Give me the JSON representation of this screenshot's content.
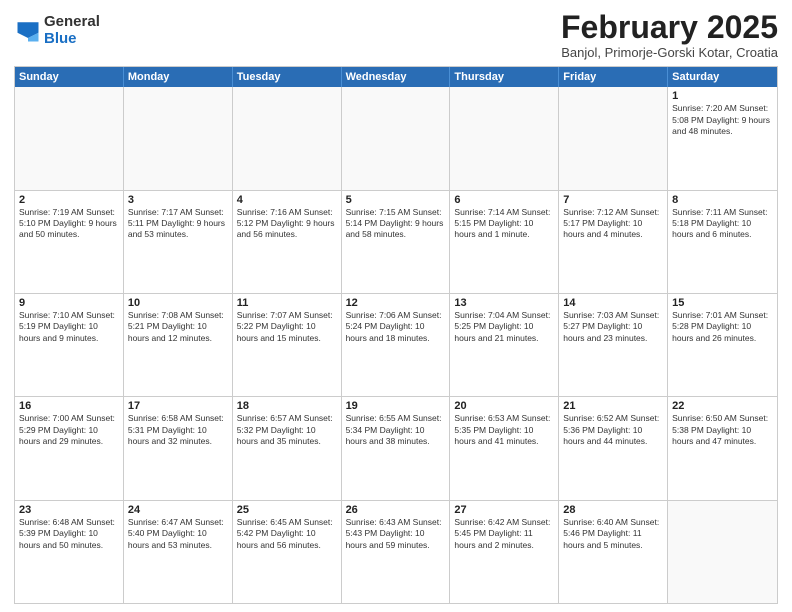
{
  "logo": {
    "general": "General",
    "blue": "Blue"
  },
  "header": {
    "month": "February 2025",
    "location": "Banjol, Primorje-Gorski Kotar, Croatia"
  },
  "days_of_week": [
    "Sunday",
    "Monday",
    "Tuesday",
    "Wednesday",
    "Thursday",
    "Friday",
    "Saturday"
  ],
  "weeks": [
    [
      {
        "day": "",
        "info": ""
      },
      {
        "day": "",
        "info": ""
      },
      {
        "day": "",
        "info": ""
      },
      {
        "day": "",
        "info": ""
      },
      {
        "day": "",
        "info": ""
      },
      {
        "day": "",
        "info": ""
      },
      {
        "day": "1",
        "info": "Sunrise: 7:20 AM\nSunset: 5:08 PM\nDaylight: 9 hours and 48 minutes."
      }
    ],
    [
      {
        "day": "2",
        "info": "Sunrise: 7:19 AM\nSunset: 5:10 PM\nDaylight: 9 hours and 50 minutes."
      },
      {
        "day": "3",
        "info": "Sunrise: 7:17 AM\nSunset: 5:11 PM\nDaylight: 9 hours and 53 minutes."
      },
      {
        "day": "4",
        "info": "Sunrise: 7:16 AM\nSunset: 5:12 PM\nDaylight: 9 hours and 56 minutes."
      },
      {
        "day": "5",
        "info": "Sunrise: 7:15 AM\nSunset: 5:14 PM\nDaylight: 9 hours and 58 minutes."
      },
      {
        "day": "6",
        "info": "Sunrise: 7:14 AM\nSunset: 5:15 PM\nDaylight: 10 hours and 1 minute."
      },
      {
        "day": "7",
        "info": "Sunrise: 7:12 AM\nSunset: 5:17 PM\nDaylight: 10 hours and 4 minutes."
      },
      {
        "day": "8",
        "info": "Sunrise: 7:11 AM\nSunset: 5:18 PM\nDaylight: 10 hours and 6 minutes."
      }
    ],
    [
      {
        "day": "9",
        "info": "Sunrise: 7:10 AM\nSunset: 5:19 PM\nDaylight: 10 hours and 9 minutes."
      },
      {
        "day": "10",
        "info": "Sunrise: 7:08 AM\nSunset: 5:21 PM\nDaylight: 10 hours and 12 minutes."
      },
      {
        "day": "11",
        "info": "Sunrise: 7:07 AM\nSunset: 5:22 PM\nDaylight: 10 hours and 15 minutes."
      },
      {
        "day": "12",
        "info": "Sunrise: 7:06 AM\nSunset: 5:24 PM\nDaylight: 10 hours and 18 minutes."
      },
      {
        "day": "13",
        "info": "Sunrise: 7:04 AM\nSunset: 5:25 PM\nDaylight: 10 hours and 21 minutes."
      },
      {
        "day": "14",
        "info": "Sunrise: 7:03 AM\nSunset: 5:27 PM\nDaylight: 10 hours and 23 minutes."
      },
      {
        "day": "15",
        "info": "Sunrise: 7:01 AM\nSunset: 5:28 PM\nDaylight: 10 hours and 26 minutes."
      }
    ],
    [
      {
        "day": "16",
        "info": "Sunrise: 7:00 AM\nSunset: 5:29 PM\nDaylight: 10 hours and 29 minutes."
      },
      {
        "day": "17",
        "info": "Sunrise: 6:58 AM\nSunset: 5:31 PM\nDaylight: 10 hours and 32 minutes."
      },
      {
        "day": "18",
        "info": "Sunrise: 6:57 AM\nSunset: 5:32 PM\nDaylight: 10 hours and 35 minutes."
      },
      {
        "day": "19",
        "info": "Sunrise: 6:55 AM\nSunset: 5:34 PM\nDaylight: 10 hours and 38 minutes."
      },
      {
        "day": "20",
        "info": "Sunrise: 6:53 AM\nSunset: 5:35 PM\nDaylight: 10 hours and 41 minutes."
      },
      {
        "day": "21",
        "info": "Sunrise: 6:52 AM\nSunset: 5:36 PM\nDaylight: 10 hours and 44 minutes."
      },
      {
        "day": "22",
        "info": "Sunrise: 6:50 AM\nSunset: 5:38 PM\nDaylight: 10 hours and 47 minutes."
      }
    ],
    [
      {
        "day": "23",
        "info": "Sunrise: 6:48 AM\nSunset: 5:39 PM\nDaylight: 10 hours and 50 minutes."
      },
      {
        "day": "24",
        "info": "Sunrise: 6:47 AM\nSunset: 5:40 PM\nDaylight: 10 hours and 53 minutes."
      },
      {
        "day": "25",
        "info": "Sunrise: 6:45 AM\nSunset: 5:42 PM\nDaylight: 10 hours and 56 minutes."
      },
      {
        "day": "26",
        "info": "Sunrise: 6:43 AM\nSunset: 5:43 PM\nDaylight: 10 hours and 59 minutes."
      },
      {
        "day": "27",
        "info": "Sunrise: 6:42 AM\nSunset: 5:45 PM\nDaylight: 11 hours and 2 minutes."
      },
      {
        "day": "28",
        "info": "Sunrise: 6:40 AM\nSunset: 5:46 PM\nDaylight: 11 hours and 5 minutes."
      },
      {
        "day": "",
        "info": ""
      }
    ]
  ]
}
